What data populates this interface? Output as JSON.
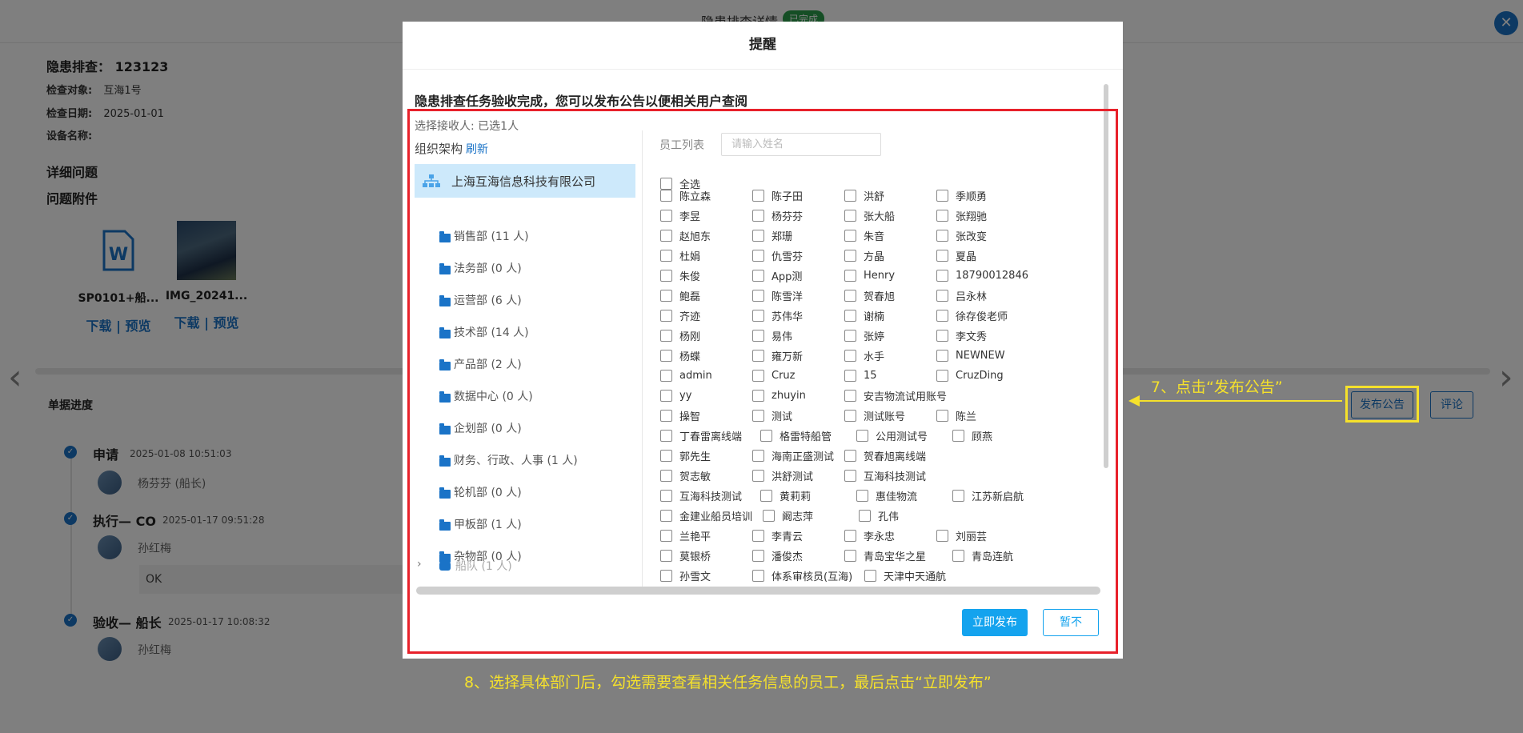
{
  "background": {
    "header_title": "隐患排查详情",
    "header_badge": "已完成",
    "title_label": "隐患排查：",
    "title_value": "123123",
    "check_object_label": "检查对象:",
    "check_object_value": "互海1号",
    "check_date_label": "检查日期:",
    "check_date_value": "2025-01-01",
    "device_name_label": "设备名称:",
    "detail_heading": "详细问题",
    "attachment_heading": "问题附件",
    "attachments": [
      {
        "name": "SP0101+船...",
        "links": "下载 | 预览"
      },
      {
        "name": "IMG_20241...",
        "links": "下载 | 预览"
      }
    ],
    "bill_progress": "单据进度",
    "timeline": [
      {
        "step": "申请",
        "time": "2025-01-08 10:51:03",
        "person": "杨芬芬 (船长)"
      },
      {
        "step": "执行— CO",
        "time": "2025-01-17 09:51:28",
        "person": "孙红梅",
        "comment": "OK"
      },
      {
        "step": "验收— 船长",
        "time": "2025-01-17 10:08:32",
        "person": "孙红梅"
      }
    ],
    "publish_button": "发布公告",
    "comment_button": "评论"
  },
  "annotations": {
    "step7": "7、点击“发布公告”",
    "step8": "8、选择具体部门后，勾选需要查看相关任务信息的员工，最后点击“立即发布”"
  },
  "modal": {
    "title": "提醒",
    "message": "隐患排查任务验收完成，您可以发布公告以便相关用户查阅",
    "receivers": "选择接收人:  已选1人",
    "org_label": "组织架构",
    "refresh": "刷新",
    "root_org": "上海互海信息科技有限公司",
    "departments": [
      "销售部 (11 人)",
      "法务部 (0 人)",
      "运营部 (6 人)",
      "技术部 (14 人)",
      "产品部 (2 人)",
      "数据中心 (0 人)",
      "企划部 (0 人)",
      "财务、行政、人事 (1 人)",
      "轮机部 (0 人)",
      "甲板部 (1 人)",
      "杂物部 (0 人)"
    ],
    "fleet": "船队 (1 人)",
    "employee_list_label": "员工列表",
    "search_placeholder": "请输入姓名",
    "select_all": "全选",
    "employee_rows": [
      [
        "陈立森",
        "陈子田",
        "洪舒",
        "季顺勇"
      ],
      [
        "李昱",
        "杨芬芬",
        "张大船",
        "张翔驰"
      ],
      [
        "赵旭东",
        "郑珊",
        "朱音",
        "张改变"
      ],
      [
        "杜娟",
        "仇雪芬",
        "方晶",
        "夏晶"
      ],
      [
        "朱俊",
        "App测",
        "Henry",
        "18790012846"
      ],
      [
        "鲍磊",
        "陈雪洋",
        "贺春旭",
        "吕永林"
      ],
      [
        "齐迹",
        "苏伟华",
        "谢楠",
        "徐存俊老师"
      ],
      [
        "杨刚",
        "易伟",
        "张婷",
        "李文秀"
      ],
      [
        "杨蝶",
        "雍万新",
        "水手",
        "NEWNEW"
      ],
      [
        "admin",
        "Cruz",
        "15",
        "CruzDing"
      ],
      [
        "yy",
        "zhuyin",
        "安吉物流试用账号"
      ],
      [
        "操智",
        "测试",
        "测试账号",
        "陈兰"
      ],
      [
        "丁春雷离线端",
        "格雷特船管",
        "公用测试号",
        "顾燕"
      ],
      [
        "郭先生",
        "海南正盛测试",
        "贺春旭离线端"
      ],
      [
        "贺志敏",
        "洪舒测试",
        "互海科技测试"
      ],
      [
        "互海科技测试",
        "黄莉莉",
        "惠佳物流",
        "江苏新启航"
      ],
      [
        "金建业船员培训",
        "阚志萍",
        "孔伟"
      ],
      [
        "兰艳平",
        "李青云",
        "李永忠",
        "刘丽芸"
      ],
      [
        "莫银桥",
        "潘俊杰",
        "青岛宝华之星",
        "青岛连航"
      ],
      [
        "孙雪文",
        "体系审核员(互海)",
        "天津中天通航"
      ]
    ],
    "publish_now": "立即发布",
    "not_now": "暂不"
  }
}
